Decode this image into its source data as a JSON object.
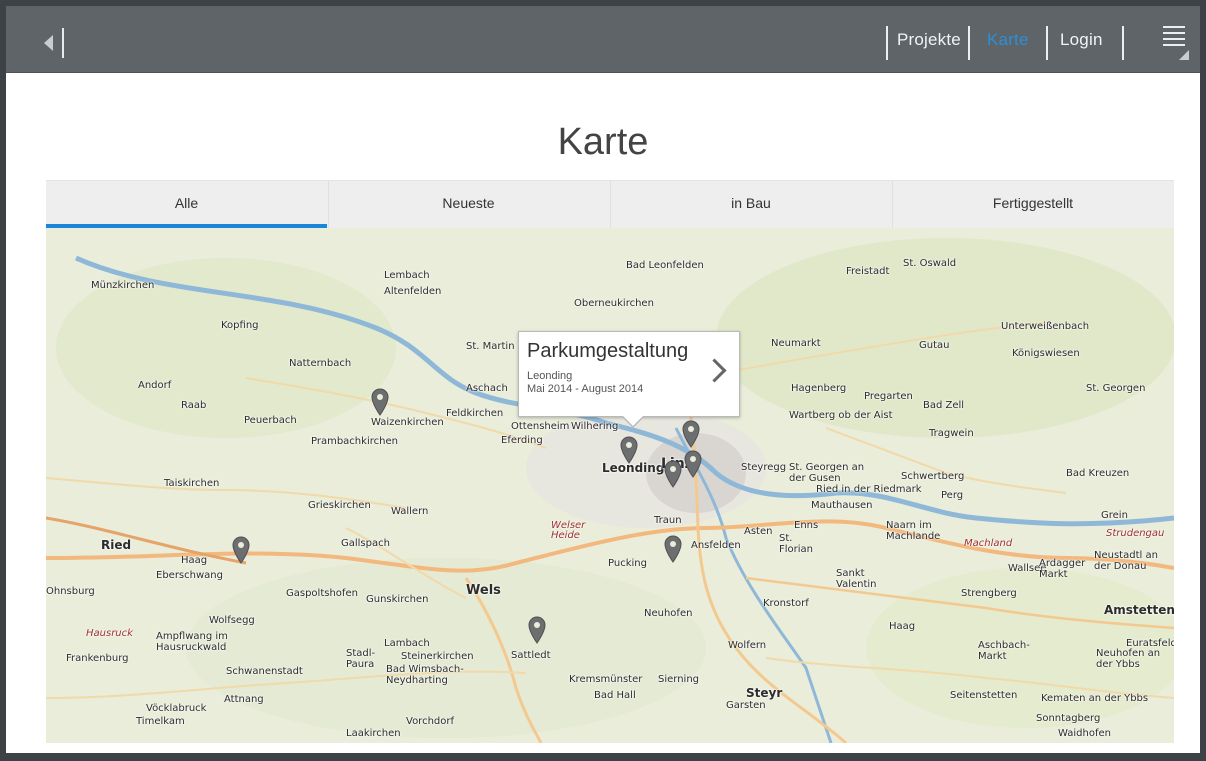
{
  "nav": {
    "items": [
      {
        "label": "Projekte"
      },
      {
        "label": "Karte"
      },
      {
        "label": "Login"
      }
    ],
    "active_color": "#2c8fd6"
  },
  "page": {
    "title": "Karte"
  },
  "tabs": [
    {
      "label": "Alle",
      "active": true
    },
    {
      "label": "Neueste",
      "active": false
    },
    {
      "label": "in Bau",
      "active": false
    },
    {
      "label": "Fertiggestellt",
      "active": false
    }
  ],
  "popup": {
    "title": "Parkumgestaltung",
    "location": "Leonding",
    "period": "Mai 2014 - August 2014"
  },
  "map": {
    "places": [
      "Münzkirchen",
      "Lembach",
      "Altenfelden",
      "Kopfing",
      "Natternbach",
      "St. Martin",
      "Bad Leonfelden",
      "Oberneukirchen",
      "Freistadt",
      "St. Oswald",
      "Andorf",
      "Raab",
      "Peuerbach",
      "Waizenkirchen",
      "Prambachkirchen",
      "Aschach",
      "Feldkirchen",
      "Ottensheim",
      "Wilhering",
      "Eferding",
      "Leonding",
      "Linz",
      "Neumarkt",
      "Hagenberg",
      "Pregarten",
      "Bad Zell",
      "Wartberg ob der Aist",
      "Tragwein",
      "Gutau",
      "Unterweißenbach",
      "Königswiesen",
      "St. Georgen",
      "Taiskirchen",
      "Grieskirchen",
      "Wallern",
      "Steyregg",
      "St. Georgen an der Gusen",
      "Ried in der Riedmark",
      "Schwertberg",
      "Perg",
      "Mauthausen",
      "Bad Kreuzen",
      "Grein",
      "Ried",
      "Haag",
      "Eberschwang",
      "Gallspach",
      "Traun",
      "Asten",
      "Enns",
      "Ansfelden",
      "St. Florian",
      "Naarn im Machlande",
      "Machland",
      "Strudengau",
      "Wallsee",
      "Ardagger Markt",
      "Neustadtl an der Donau",
      "Pucking",
      "Wels",
      "Welser Heide",
      "Gaspoltshofen",
      "Gunskirchen",
      "Sankt Valentin",
      "Strengberg",
      "Wolfsegg",
      "Hausruck",
      "Ampflwang im Hausruckwald",
      "Frankenburg",
      "Neuhofen",
      "Kronstorf",
      "Amstetten",
      "Haag",
      "Lambach",
      "Stadl-Paura",
      "Steinerkirchen",
      "Bad Wimsbach-Neydharting",
      "Schwanenstadt",
      "Sattledt",
      "Wolfern",
      "Aschbach-Markt",
      "Neuhofen an der Ybbs",
      "Kremsmünster",
      "Sierning",
      "Bad Hall",
      "Steyr",
      "Garsten",
      "Seitenstetten",
      "Kematen an der Ybbs",
      "Sonntagberg",
      "Vöcklabruck",
      "Attnang",
      "Timelkam",
      "Vorchdorf",
      "Laakirchen",
      "Waidhofen",
      "Euratsfeld",
      "Ohnsburg"
    ],
    "pins_count": 8
  }
}
